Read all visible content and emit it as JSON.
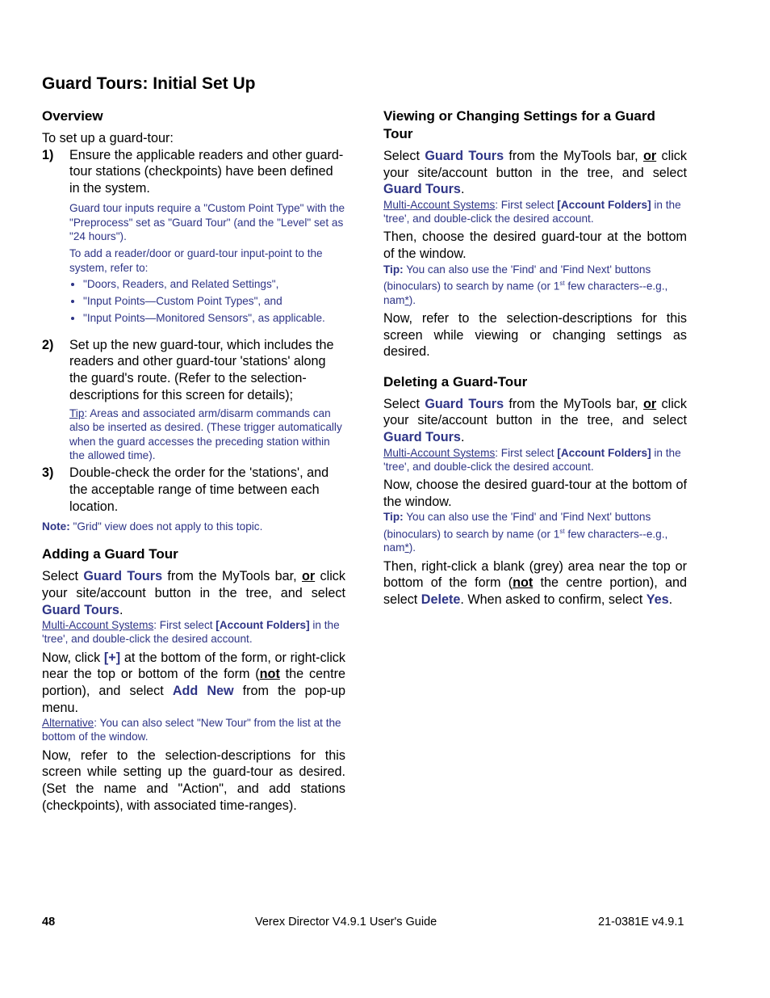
{
  "title": "Guard Tours:  Initial Set Up",
  "overview": {
    "heading": "Overview",
    "intro": "To set up a guard-tour:",
    "steps": [
      {
        "num": "1)",
        "text": "Ensure the applicable readers and other guard-tour stations (checkpoints) have been defined in the system."
      },
      {
        "num": "2)",
        "text": "Set up the new guard-tour, which includes the readers and other guard-tour 'stations' along the guard's route.  (Refer to the selection-descriptions for this screen for details);"
      },
      {
        "num": "3)",
        "text": "Double-check the order for the 'stations', and the acceptable range of time between each location."
      }
    ],
    "step1_note1": "Guard tour inputs require a \"Custom Point Type\" with the \"Preprocess\" set as \"Guard Tour\" (and the \"Level\" set as \"24 hours\").",
    "step1_note2": "To add a reader/door or guard-tour input-point to the system, refer to:",
    "refs": [
      "\"Doors, Readers, and Related Settings\",",
      "\"Input Points—Custom Point Types\", and",
      "\"Input Points—Monitored Sensors\", as applicable."
    ],
    "step2_tip_label": "Tip",
    "step2_tip_text": ":  Areas and associated arm/disarm commands can also be inserted as desired.  (These trigger automatically when the guard accesses the preceding station within the allowed time).",
    "note_label": "Note:",
    "note_text": "  \"Grid\" view does not apply to this topic."
  },
  "common": {
    "select": "Select ",
    "guard_tours": "Guard Tours",
    "from_bar": " from the MyTools bar, ",
    "or": "or",
    "click_site": " click your site/account button in the tree, and select ",
    "period": ".",
    "mas_label": "Multi-Account Systems",
    "mas_text1": ":  First select ",
    "mas_bold": "[Account Folders]",
    "mas_text2": " in the 'tree', and double-click the desired account.",
    "tip_label": "Tip:",
    "tip_text1": "  You can also use the 'Find' and 'Find Next' buttons (binoculars) to search by name (or 1",
    "tip_sup": "st",
    "tip_text2": " few characters--e.g., nam",
    "tip_star": "*",
    "tip_text3": ")."
  },
  "adding": {
    "heading": "Adding a Guard Tour",
    "now_click": "Now, click ",
    "plus": "[+]",
    "p2a": " at the bottom of the form, or right-click near the top or bottom of the form (",
    "not": "not",
    "p2b": " the centre portion), and select ",
    "add_new": "Add New",
    "p2c": " from the pop-up menu.",
    "alt_label": "Alternative",
    "alt_text": ":  You can also select \"New Tour\" from the list at the bottom of the window.",
    "final": "Now, refer to the selection-descriptions for this screen while setting up the guard-tour as desired.  (Set the name and \"Action\", and add stations (checkpoints), with associated time-ranges)."
  },
  "viewing": {
    "heading": "Viewing or Changing Settings for a Guard Tour",
    "choose": "Then, choose the desired guard-tour at the bottom of the window.",
    "final": "Now, refer to the selection-descriptions for this screen while viewing or changing settings as desired."
  },
  "deleting": {
    "heading": "Deleting a Guard-Tour",
    "choose": "Now, choose the desired guard-tour at the bottom of the window.",
    "p_a": "Then, right-click a blank (grey) area near the top or bottom of the form (",
    "not": "not",
    "p_b": " the centre portion), and select ",
    "delete": "Delete",
    "p_c": ".  When asked to confirm, select ",
    "yes": "Yes",
    "p_d": "."
  },
  "footer": {
    "page_number": "48",
    "guide_title": "Verex Director V4.9.1 User's Guide",
    "doc_code": "21-0381E v4.9.1"
  }
}
